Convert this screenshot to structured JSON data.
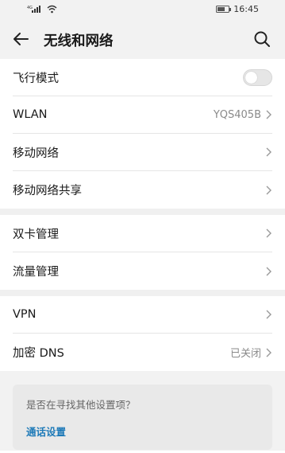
{
  "status_bar": {
    "time": "16:45",
    "signal_text": "4G",
    "battery_level": 0.55
  },
  "app_bar": {
    "title": "无线和网络",
    "back_icon": "arrow-left-icon",
    "search_icon": "search-icon"
  },
  "groups": [
    {
      "items": [
        {
          "label": "飞行模式",
          "type": "toggle",
          "on": false
        },
        {
          "label": "WLAN",
          "value": "YQS405B",
          "type": "nav"
        },
        {
          "label": "移动网络",
          "type": "nav"
        },
        {
          "label": "移动网络共享",
          "type": "nav"
        }
      ]
    },
    {
      "items": [
        {
          "label": "双卡管理",
          "type": "nav"
        },
        {
          "label": "流量管理",
          "type": "nav"
        }
      ]
    },
    {
      "items": [
        {
          "label": "VPN",
          "type": "nav"
        },
        {
          "label": "加密 DNS",
          "value": "已关闭",
          "type": "nav"
        }
      ]
    }
  ],
  "suggestion": {
    "question": "是否在寻找其他设置项？",
    "link": "通话设置"
  },
  "colors": {
    "link": "#1e7ab8",
    "background": "#f2f2f2"
  }
}
